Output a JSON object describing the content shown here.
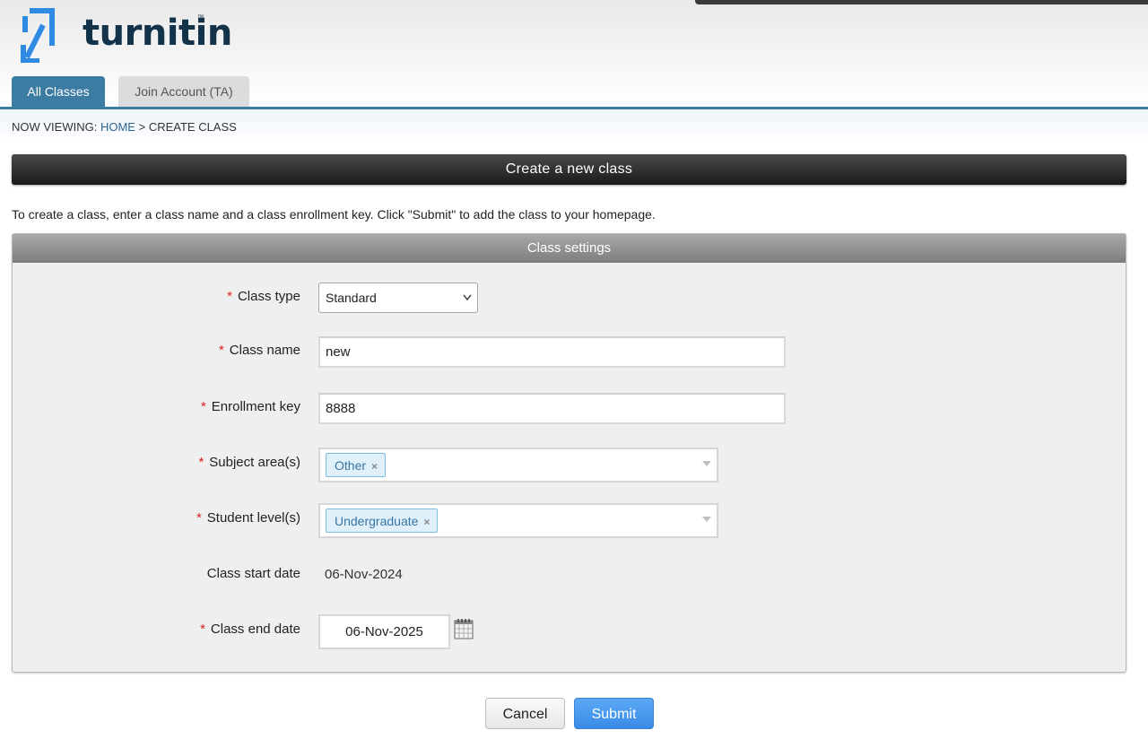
{
  "brand": {
    "name": "turnitin",
    "trademark": "™",
    "color": "#13334a"
  },
  "tabs": [
    {
      "label": "All Classes",
      "active": true
    },
    {
      "label": "Join Account (TA)",
      "active": false
    }
  ],
  "breadcrumb": {
    "prefix": "NOW VIEWING:",
    "home": "HOME",
    "separator": ">",
    "current": "CREATE CLASS"
  },
  "page": {
    "title": "Create a new class",
    "intro": "To create a class, enter a class name and a class enrollment key. Click \"Submit\" to add the class to your homepage."
  },
  "panel": {
    "title": "Class settings",
    "required_marker": "*",
    "fields": {
      "class_type": {
        "label": "Class type",
        "value": "Standard"
      },
      "class_name": {
        "label": "Class name",
        "value": "new"
      },
      "enrollment_key": {
        "label": "Enrollment key",
        "value": "8888"
      },
      "subject_areas": {
        "label": "Subject area(s)",
        "chip": "Other",
        "remove": "×"
      },
      "student_levels": {
        "label": "Student level(s)",
        "chip": "Undergraduate",
        "remove": "×"
      },
      "start_date": {
        "label": "Class start date",
        "value": "06-Nov-2024"
      },
      "end_date": {
        "label": "Class end date",
        "value": "06-Nov-2025"
      }
    }
  },
  "actions": {
    "cancel": "Cancel",
    "submit": "Submit"
  },
  "colors": {
    "accent": "#3c7ca3",
    "submit": "#4a9af0",
    "required": "#dd2222"
  }
}
